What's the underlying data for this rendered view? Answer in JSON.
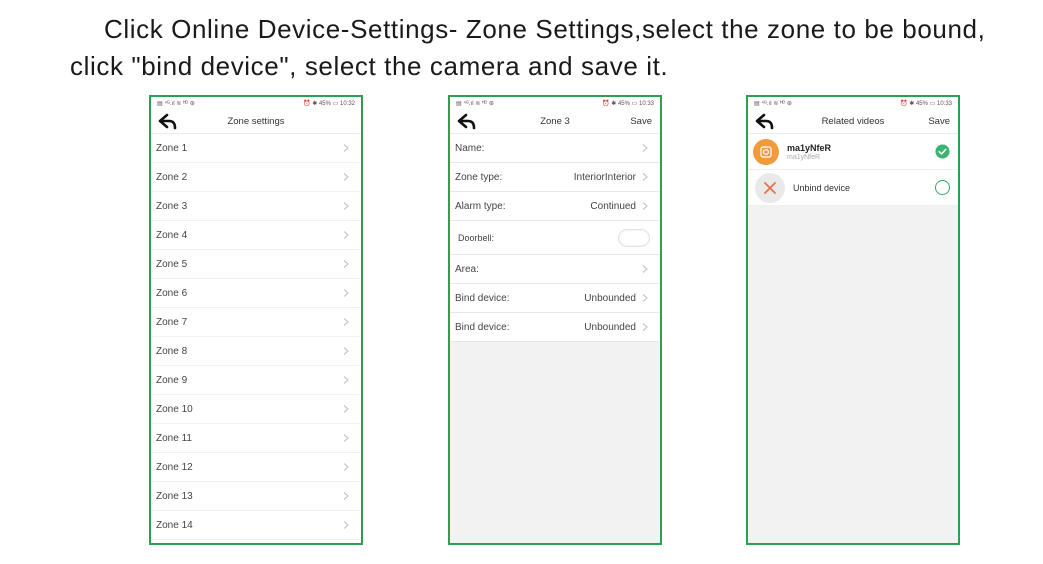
{
  "instructions": {
    "line1": "Click Online Device-Settings- Zone Settings,select the zone to be bound,",
    "line2": "click \"bind device\", select the camera and save it."
  },
  "colors": {
    "frame": "#2e9e4f",
    "avatar": "#f39a3a",
    "check": "#3cb371",
    "unbind_x": "#e8704a"
  },
  "screen1": {
    "status_left": "▤ ⁴ᴳ.ıl ≋ ᴴᴰ ⊛",
    "status_right": "⏰ ✱ 45% ▭ 10:32",
    "title": "Zone settings",
    "zones": [
      "Zone 1",
      "Zone 2",
      "Zone 3",
      "Zone 4",
      "Zone 5",
      "Zone 6",
      "Zone 7",
      "Zone 8",
      "Zone 9",
      "Zone 10",
      "Zone 11",
      "Zone 12",
      "Zone 13",
      "Zone 14"
    ]
  },
  "screen2": {
    "status_left": "▤ ⁴ᴳ.ıl ≋ ᴴᴰ ⊛",
    "status_right": "⏰ ✱ 45% ▭ 10:33",
    "title": "Zone 3",
    "save": "Save",
    "name_label": "Name:",
    "zone_type_label": "Zone type:",
    "zone_type_value": "InteriorInterior",
    "alarm_type_label": "Alarm type:",
    "alarm_type_value": "Continued",
    "doorbell_label": "Doorbell:",
    "area_label": "Area:",
    "bind1_label": "Bind device:",
    "bind1_value": "Unbounded",
    "bind2_label": "Bind device:",
    "bind2_value": "Unbounded"
  },
  "screen3": {
    "status_left": "▤ ⁴ᴳ.ıl ≋ ᴴᴰ ⊛",
    "status_right": "⏰ ✱ 45% ▭ 10:33",
    "title": "Related videos",
    "save": "Save",
    "camera_name": "ma1yNfeR",
    "camera_sub": "ma1yNfeR",
    "unbind_label": "Unbind device"
  }
}
